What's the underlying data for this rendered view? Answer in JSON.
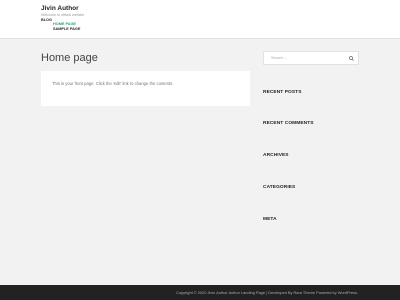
{
  "header": {
    "site_title": "Jivin Author",
    "site_description": "Welcome to official website",
    "nav": {
      "blog_label": "BLOG",
      "submenu": [
        {
          "label": "HOME PAGE",
          "active": true
        },
        {
          "label": "SAMPLE PAGE",
          "active": false
        }
      ]
    }
  },
  "main": {
    "page_title": "Home page",
    "content_text": "This is your front page. Click the 'edit' link to change the contents"
  },
  "sidebar": {
    "search_placeholder": "Search ...",
    "widgets": [
      "RECENT POSTS",
      "RECENT COMMENTS",
      "ARCHIVES",
      "CATEGORIES",
      "META"
    ]
  },
  "footer": {
    "text": "Copyright © 2020 Jivin Author Author Landing Page | Developed By Rara Theme Powered by WordPress."
  },
  "colors": {
    "accent": "#2e9e6a",
    "footer_bg": "#222222",
    "page_bg": "#f2f2f2"
  }
}
